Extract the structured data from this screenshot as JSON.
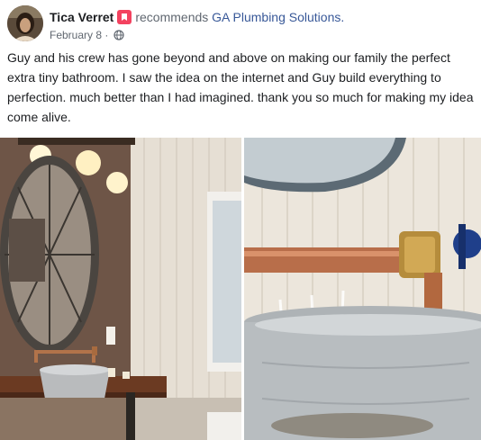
{
  "post": {
    "author": "Tica Verret",
    "verb": "recommends",
    "page": "GA Plumbing Solutions.",
    "date": "February 8",
    "separator": " · ",
    "text": "Guy and his crew has gone beyond and above on making our family the perfect extra tiny bathroom. I saw the idea on the internet and Guy build everything to perfection. much better than I had imagined. thank you so much for making my idea come alive."
  },
  "icons": {
    "recommend_badge": "recommend-icon",
    "privacy": "globe-icon"
  },
  "colors": {
    "link": "#385898",
    "meta": "#606770",
    "badge": "#f3425f"
  },
  "photos": [
    {
      "label": "bathroom-vanity-photo"
    },
    {
      "label": "faucet-washtub-photo"
    }
  ]
}
